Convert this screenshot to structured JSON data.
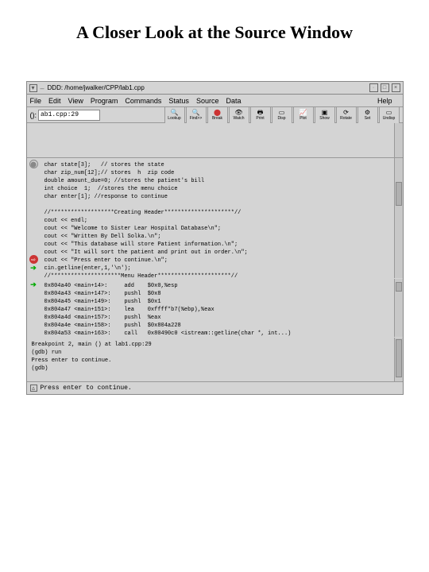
{
  "slide": {
    "title": "A Closer Look at the Source Window"
  },
  "titlebar": {
    "text": "DDD: /home/jwalker/CPP/lab1.cpp"
  },
  "menubar": {
    "file": "File",
    "edit": "Edit",
    "view": "View",
    "program": "Program",
    "commands": "Commands",
    "status": "Status",
    "source": "Source",
    "data": "Data",
    "help": "Help"
  },
  "argrow": {
    "paren": "():",
    "value": "ab1.cpp:29"
  },
  "toolbar": {
    "lookup": "Lookup",
    "find": "Find>>",
    "break": "Break",
    "watch": "Watch",
    "print": "Print",
    "display": "Disp",
    "plot": "Plot",
    "show": "Show",
    "rotate": "Rotate",
    "set": "Set",
    "undisp": "Undisp"
  },
  "source": {
    "text": "char state[3];   // stores the state\nchar zip_num[12];// stores  h  zip code\ndouble amount_due=0; //stores the patient's bill\nint choice  1;  //stores the menu choice\nchar enter[1]; //response to continue\n\n//*******************Creating Header*********************//\ncout << endl;\ncout << \"Welcome to Sister Lear Hospital Database\\n\";\ncout << \"Written By Dell Solka.\\n\";\ncout << \"This database will store Patient information.\\n\";\ncout << \"It will sort the patient and print out in order.\\n\";\ncout << \"Press enter to continue.\\n\";\ncin.getline(enter,1,'\\n');\n//*********************Menu Header**********************//"
  },
  "asm": {
    "text": "0x804a40 <main+14>:     add    $0x0,%esp\n0x804a43 <main+147>:    pushl  $0x8\n0x804a45 <main+149>:    pushl  $0x1\n0x804a47 <main+151>:    lea    0xffff*b7(%ebp),%eax\n0x804a4d <main+157>:    pushl  %eax\n0x804a4e <main+158>:    pushl  $0x804a228\n0x804a53 <main+163>:    call   0x80490c0 <istream::getline(char *, int...)"
  },
  "gdb": {
    "text": "Breakpoint 2, main () at lab1.cpp:29\n(gdb) run\nPress enter to continue.\n(gdb)"
  },
  "statusbar": {
    "text": "Press enter to continue."
  }
}
